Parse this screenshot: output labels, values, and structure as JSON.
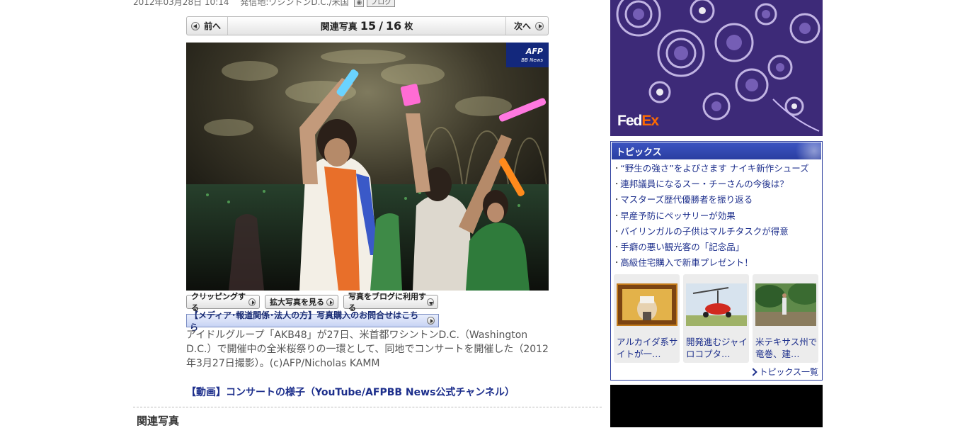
{
  "meta": {
    "date": "2012年03月28日 10:14",
    "location": "発信地:ワシントンD.C./米国",
    "blog_label": "ブログ"
  },
  "pager": {
    "prev_label": "前へ",
    "next_label": "次へ",
    "label": "関連写真",
    "current": "15",
    "separator": "/",
    "total": "16",
    "unit": "枚"
  },
  "photo": {
    "afp_logo": "AFP",
    "afp_sub": "BB News"
  },
  "photo_actions": {
    "clip_label": "クリッピングする",
    "enlarge_label": "拡大写真を見る",
    "blog_label": "写真をブログに利用する"
  },
  "media_inquiry_label": "【メディア･報道関係･法人の方】写真購入のお問合せはこちら",
  "caption": "アイドルグループ「AKB48」が27日、米首都ワシントンD.C.（Washington D.C.）で開催中の全米桜祭りの一環として、同地でコンサートを開催した（2012年3月27日撮影）。(c)AFP/Nicholas KAMM",
  "video_link": "【動画】コンサートの様子（YouTube/AFPBB News公式チャンネル）",
  "related_heading": "関連写真",
  "ad": {
    "brand_fed": "Fed",
    "brand_ex": "Ex",
    "colors": {
      "bg": "#3b2a76",
      "accent": "#ff6a00"
    }
  },
  "topics": {
    "title": "トピックス",
    "items": [
      "“野生の強さ”をよびさます ナイキ新作シューズ",
      "連邦議員になるスー・チーさんの今後は？",
      "マスターズ歴代優勝者を振り返る",
      "早産予防にペッサリーが効果",
      "バイリンガルの子供はマルチタスクが得意",
      "手癖の悪い観光客の「記念品」",
      "高級住宅購入で新車プレゼント！"
    ],
    "bullet": "･",
    "thumbs": [
      {
        "caption": "アルカイダ系サイトが一…"
      },
      {
        "caption": "開発進むジャイロコプタ…"
      },
      {
        "caption": "米テキサス州で竜巻、建…"
      }
    ],
    "more_label": "トピックス一覧"
  }
}
